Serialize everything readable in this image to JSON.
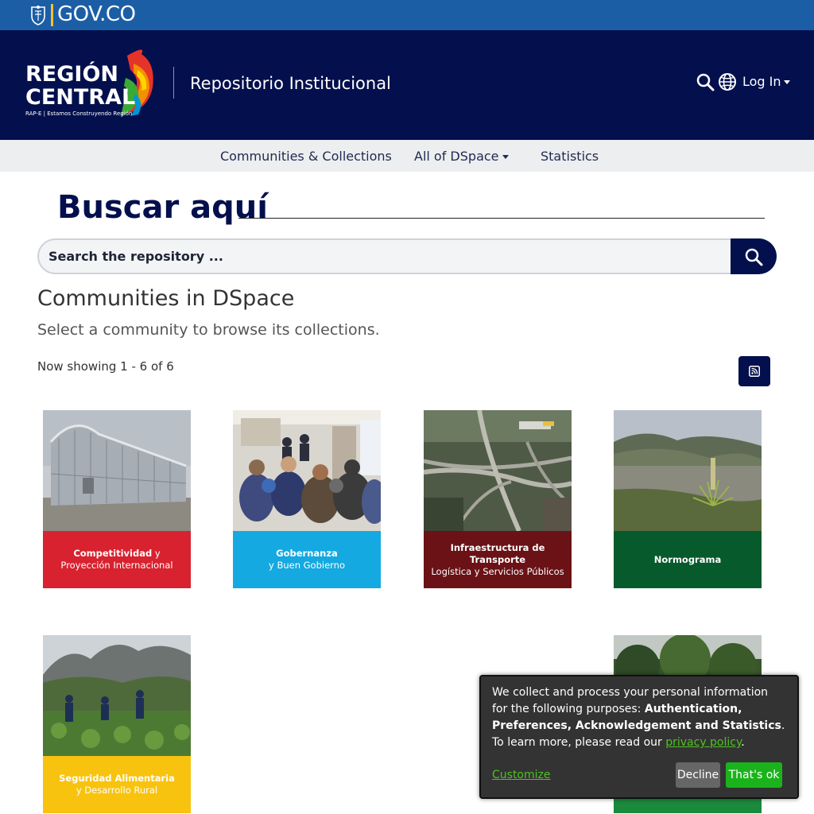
{
  "gov_bar": {
    "text": "GOV.CO"
  },
  "header": {
    "logo_line1": "REGIÓN",
    "logo_line2": "CENTRAL",
    "logo_tagline": "RAP-E | Estamos Construyendo Región",
    "repo_title": "Repositorio Institucional",
    "login_label": "Log In"
  },
  "nav": {
    "items": [
      {
        "label": "Communities & Collections"
      },
      {
        "label": "All of DSpace"
      },
      {
        "label": "Statistics"
      }
    ]
  },
  "search": {
    "heading": "Buscar aquí",
    "placeholder": "Search the repository ..."
  },
  "main": {
    "title": "Communities in DSpace",
    "subtitle": "Select a community to browse its collections.",
    "showing": "Now showing 1 - 6 of 6"
  },
  "cards": [
    {
      "bold": "Competitividad",
      "rest": " y",
      "line2": "Proyección Internacional",
      "band_color": "#d8222f",
      "photo": "greenhouse"
    },
    {
      "bold": "Gobernanza",
      "rest": "",
      "line2": "y Buen Gobierno",
      "band_color": "#14a9e0",
      "photo": "meeting"
    },
    {
      "bold": "Infraestructura de Transporte",
      "rest": "",
      "line2": "Logística y Servicios Públicos",
      "band_color": "#6a1216",
      "photo": "highway"
    },
    {
      "bold": "Normograma",
      "rest": "",
      "line2": "",
      "band_color": "#075a2b",
      "photo": "lake"
    },
    {
      "bold": "Seguridad Alimentaria",
      "rest": "",
      "line2": "y Desarrollo Rural",
      "band_color": "#f8c30f",
      "photo": "farm"
    },
    {
      "bold": "",
      "rest": "",
      "line2": "",
      "band_color": "#1a8a3c",
      "photo": "forest"
    }
  ],
  "consent": {
    "text_before": "We collect and process your personal information for the following purposes: ",
    "purposes": "Authentication, Preferences, Acknowledgement and Statistics",
    "period": ".",
    "learn_more": "To learn more, please read our ",
    "privacy_link": "privacy policy",
    "customize": "Customize",
    "decline": "Decline",
    "accept": "That's ok"
  }
}
